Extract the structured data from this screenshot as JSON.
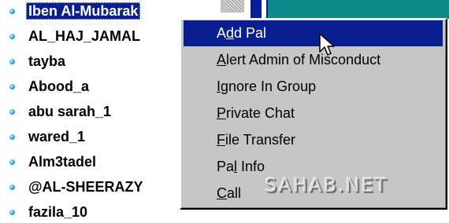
{
  "user_list": {
    "items": [
      {
        "name": "Iben Al-Mubarak",
        "selected": true
      },
      {
        "name": "AL_HAJ_JAMAL"
      },
      {
        "name": "tayba"
      },
      {
        "name": "Abood_a"
      },
      {
        "name": "abu sarah_1"
      },
      {
        "name": "wared_1"
      },
      {
        "name": "Alm3tadel"
      },
      {
        "name": "@AL-SHEERAZY"
      },
      {
        "name": "fazila_10"
      }
    ]
  },
  "context_menu": {
    "items": [
      {
        "pre": "A",
        "key": "d",
        "post": "d Pal",
        "highlighted": true
      },
      {
        "pre": "",
        "key": "A",
        "post": "lert Admin of Misconduct"
      },
      {
        "pre": "",
        "key": "I",
        "post": "gnore In Group"
      },
      {
        "pre": "",
        "key": "P",
        "post": "rivate Chat"
      },
      {
        "pre": "",
        "key": "F",
        "post": "ile Transfer"
      },
      {
        "pre": "Pa",
        "key": "l",
        "post": " Info"
      },
      {
        "pre": "",
        "key": "C",
        "post": "all"
      }
    ]
  },
  "watermark": {
    "text": "SAHAB.NET"
  },
  "colors": {
    "selection": "#0a1f8f",
    "menu_background": "#c6c6c6",
    "teal_panel": "#0d8a8a",
    "bullet": "#1fa0d8"
  },
  "icons": {
    "bullet": "bullet-dot-icon",
    "cursor": "mouse-pointer-icon"
  }
}
